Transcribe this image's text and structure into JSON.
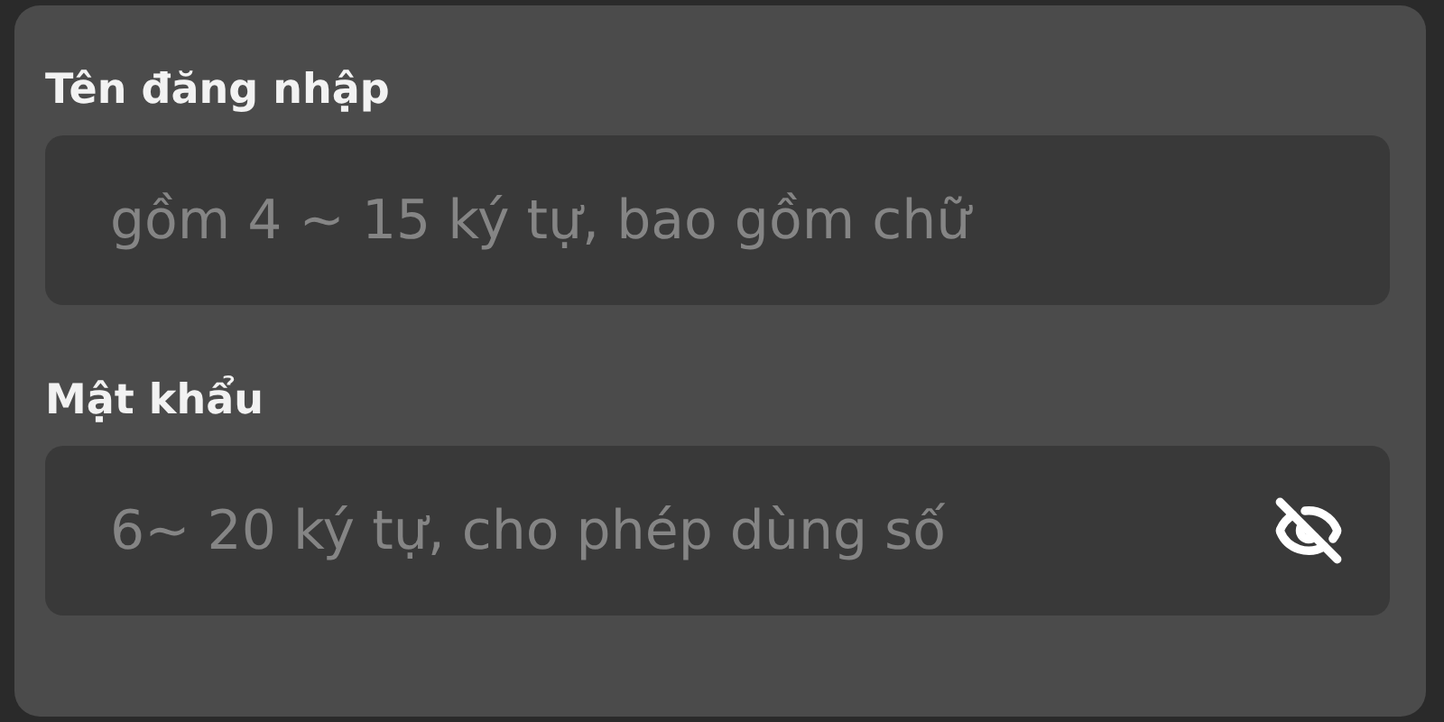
{
  "fields": [
    {
      "label": "Tên đăng nhập",
      "placeholder": "gồm 4 ~ 15 ký tự, bao gồm chữ",
      "kind": "text"
    },
    {
      "label": "Mật khẩu",
      "placeholder": "6~ 20 ký tự, cho phép dùng số",
      "kind": "password"
    }
  ]
}
